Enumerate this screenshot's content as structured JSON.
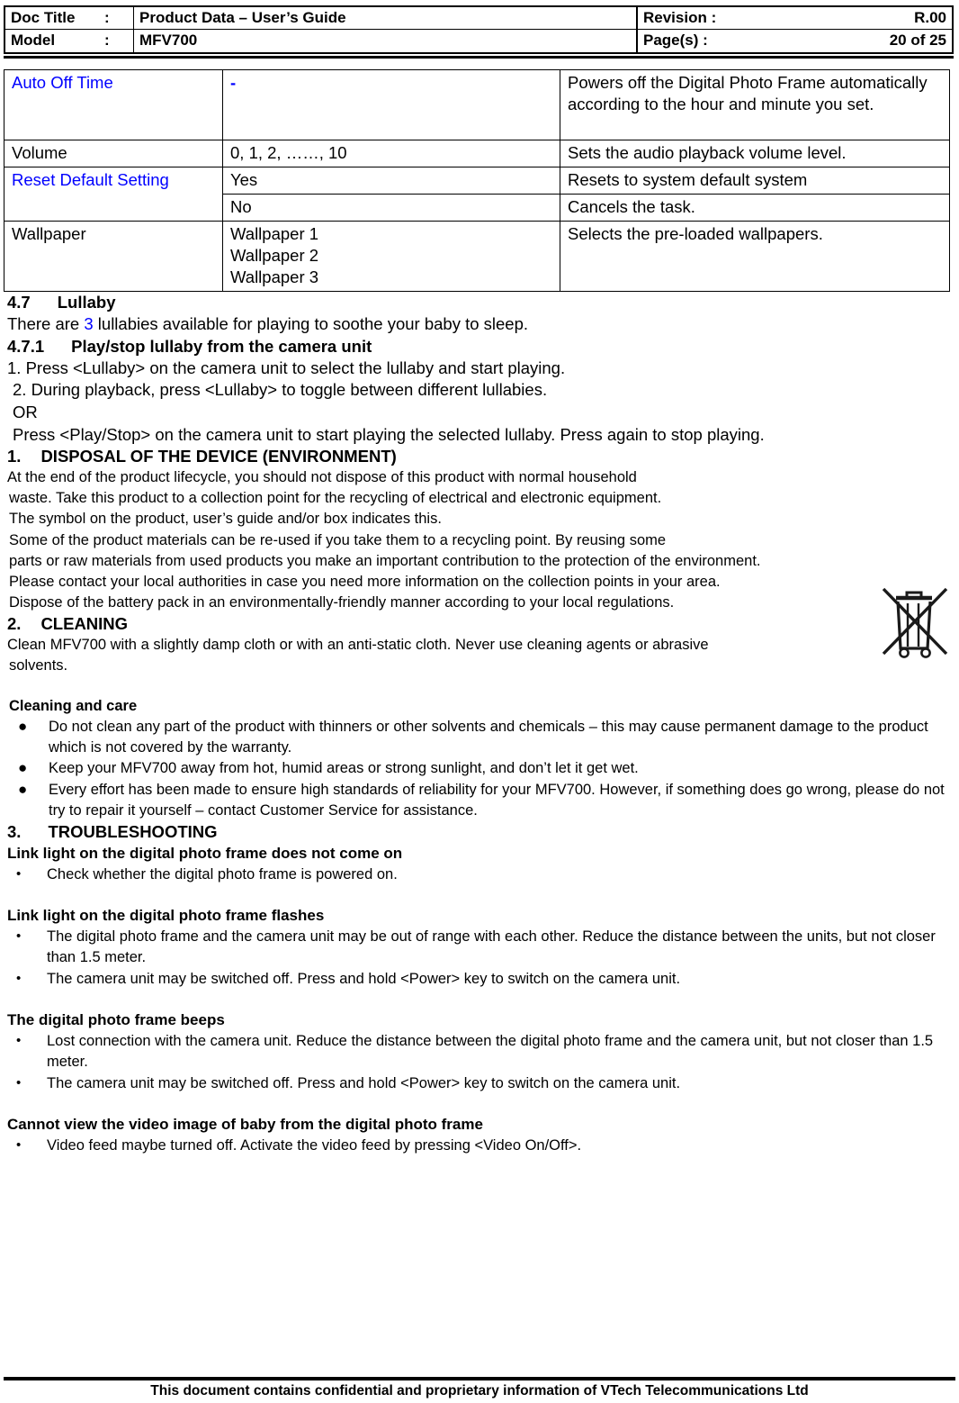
{
  "header": {
    "doc_title_label": "Doc Title",
    "model_label": "Model",
    "colon": ":",
    "doc_title_value": "Product Data – User’s Guide",
    "model_value": "MFV700",
    "revision_label": "Revision  :",
    "pages_label": "Page(s)   :",
    "revision_value": "R.00",
    "pages_value": "20 of 25"
  },
  "settings_table": {
    "rows": [
      {
        "name": "Auto Off Time",
        "name_color": "#0000ff",
        "value": "-",
        "value_color": "#0000ff",
        "description": "Powers off the Digital Photo Frame automatically according to the hour and minute you set."
      },
      {
        "name": "Volume",
        "name_color": "#000000",
        "value": "0, 1, 2, ……, 10",
        "value_color": "#000000",
        "description": "Sets the audio playback volume level."
      },
      {
        "name": "Reset Default Setting",
        "name_color": "#0000ff",
        "value": "Yes",
        "value_color": "#000000",
        "description": "Resets to system default system"
      },
      {
        "name": "",
        "name_color": "#000000",
        "value": "No",
        "value_color": "#000000",
        "description": "Cancels the task."
      },
      {
        "name": "Wallpaper",
        "name_color": "#000000",
        "value": "Wallpaper 1\nWallpaper 2\nWallpaper 3",
        "value_color": "#000000",
        "description": "Selects the pre-loaded wallpapers."
      }
    ]
  },
  "lullaby": {
    "heading_number": "4.7",
    "heading_title": "Lullaby",
    "intro_before": "There are ",
    "intro_count": "3",
    "intro_after": " lullabies available for playing to soothe your baby to sleep.",
    "sub_heading_number": "4.7.1",
    "sub_heading_title": "Play/stop lullaby from the camera unit",
    "step1": "1. Press <Lullaby> on the camera unit to select the lullaby and start playing.",
    "step2": "2. During playback, press <Lullaby> to toggle between different lullabies.",
    "or": "OR",
    "step3": "Press <Play/Stop> on the camera unit to start playing the selected lullaby. Press again to stop playing."
  },
  "disposal": {
    "heading_number": "1.",
    "heading_title": "DISPOSAL OF THE DEVICE (ENVIRONMENT)",
    "line1": "At the end of the product lifecycle, you should not dispose of this product with normal household",
    "line2": "waste. Take this product to a collection point for the recycling of electrical and electronic equipment.",
    "line3": "The symbol on the product, user’s guide and/or box indicates this.",
    "line4": "Some of the product materials can be re-used if you take them to a recycling point. By reusing some",
    "line5": "parts or raw materials from used products you make an important contribution to the protection of the environment.",
    "line6": "Please contact your local authorities in case you need more information on the collection points in your area.",
    "line7": "Dispose of the battery pack in an environmentally-friendly manner according to your local regulations.",
    "icon_name": "weee-crossed-out-wheelie-bin-icon"
  },
  "cleaning": {
    "heading_number": "2.",
    "heading_title": "CLEANING",
    "line1": "Clean MFV700 with a slightly damp cloth or with an anti-static cloth. Never use cleaning agents or abrasive",
    "line2": "solvents.",
    "subhead": "Cleaning and care",
    "bullet_glyph": "●",
    "bullets": [
      "Do not clean any part of the product with thinners or other solvents and chemicals – this may cause permanent damage to the product which is not covered by the warranty.",
      "Keep your MFV700 away from hot, humid areas or strong sunlight, and don’t let it get wet.",
      "Every effort has been made to ensure high standards of reliability for your MFV700. However, if something does go wrong, please do not try to repair it yourself – contact Customer Service for assistance."
    ]
  },
  "troubleshooting": {
    "heading_number": "3.",
    "heading_title": "TROUBLESHOOTING",
    "bullet_glyph": "•",
    "groups": [
      {
        "title": "Link light on the digital photo frame does not come on",
        "items": [
          "Check whether the digital photo frame is powered on."
        ]
      },
      {
        "title": "Link light on the digital photo frame flashes",
        "items": [
          "The digital photo frame and the camera unit may be out of range with each other. Reduce the distance between the units, but not closer than 1.5 meter.",
          "The camera unit may be switched off. Press and hold <Power> key to switch on the camera unit."
        ]
      },
      {
        "title": "The digital photo frame beeps",
        "items": [
          "Lost connection with the camera unit. Reduce the distance between the digital photo frame and the camera unit, but not closer than 1.5 meter.",
          "The camera unit may be switched off. Press and hold <Power> key to switch on the camera unit."
        ]
      },
      {
        "title": "Cannot view the video image of baby from the digital photo frame",
        "items": [
          "Video feed maybe turned off. Activate the video feed by pressing <Video On/Off>."
        ]
      }
    ]
  },
  "footer": {
    "text": "This document contains confidential and proprietary information of VTech Telecommunications Ltd"
  },
  "colors": {
    "blue": "#0000ff",
    "text": "#000000",
    "background": "#ffffff"
  }
}
